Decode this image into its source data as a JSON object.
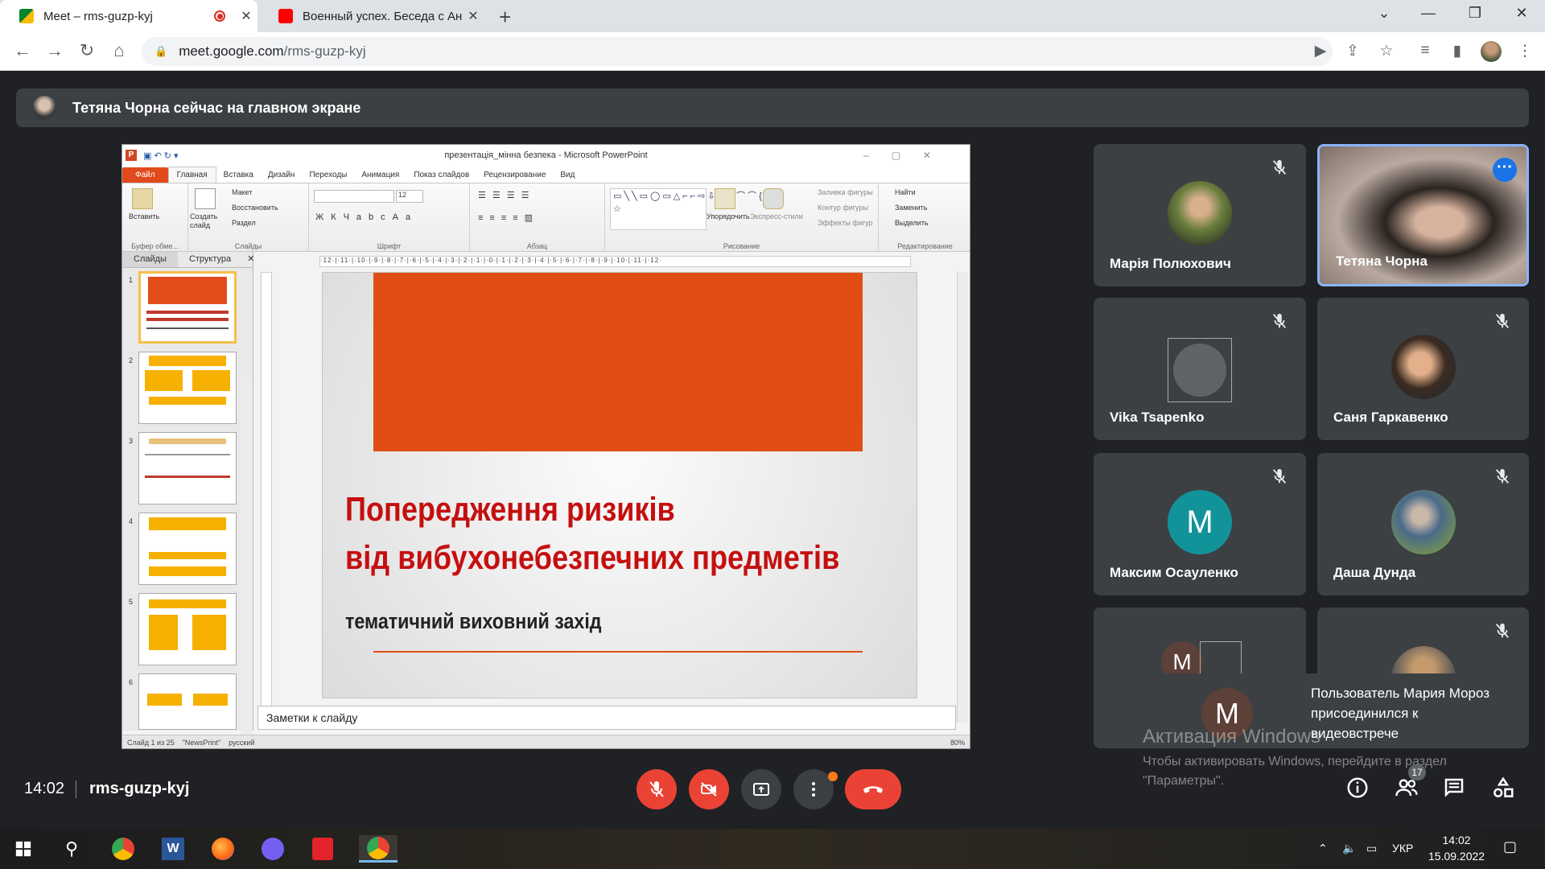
{
  "browser": {
    "tabs": [
      {
        "title": "Meet – rms-guzp-kyj",
        "active": true
      },
      {
        "title": "Военный успех. Беседа с Андреем",
        "active": false
      }
    ],
    "url_host": "meet.google.com",
    "url_path": "/rms-guzp-kyj"
  },
  "presentation_banner": "Тетяна Чорна сейчас на главном экране",
  "powerpoint": {
    "window_title": "презентація_мінна безпека - Microsoft PowerPoint",
    "menu": [
      "Файл",
      "Главная",
      "Вставка",
      "Дизайн",
      "Переходы",
      "Анимация",
      "Показ слайдов",
      "Рецензирование",
      "Вид"
    ],
    "groups": {
      "clipboard": "Буфер обме...",
      "slides": "Слайды",
      "font": "Шрифт",
      "paragraph": "Абзац",
      "drawing": "Рисование",
      "editing": "Редактирование"
    },
    "buttons": {
      "paste": "Вставить",
      "new_slide": "Создать слайд",
      "layout": "Макет",
      "reset": "Восстановить",
      "section": "Раздел",
      "arrange": "Упорядочить",
      "quick_styles": "Экспресс-стили",
      "shape_fill": "Заливка фигуры",
      "shape_outline": "Контур фигуры",
      "shape_effects": "Эффекты фигур",
      "find": "Найти",
      "replace": "Заменить",
      "select": "Выделить",
      "font_size": "12"
    },
    "pane_tabs": [
      "Слайды",
      "Структура"
    ],
    "thumb_numbers": [
      "1",
      "2",
      "3",
      "4",
      "5",
      "6"
    ],
    "slide": {
      "line1": "Попередження ризиків",
      "line2": "від вибухонебезпечних предметів",
      "subtitle": "тематичний виховний захід"
    },
    "notes_placeholder": "Заметки к слайду",
    "status": {
      "slide_counter": "Слайд 1 из 25",
      "theme": "\"NewsPrint\"",
      "language": "русский",
      "zoom": "80%"
    }
  },
  "participants": [
    {
      "name": "Марія Полюхович",
      "muted": true,
      "avatar": "photo"
    },
    {
      "name": "Тетяна Чорна",
      "muted": false,
      "avatar": "video",
      "speaking": true
    },
    {
      "name": "Vika Tsapenko",
      "muted": true,
      "avatar": "broken-image"
    },
    {
      "name": "Саня Гаркавенко",
      "muted": true,
      "avatar": "photo"
    },
    {
      "name": "Максим Осауленко",
      "muted": true,
      "avatar": "letter",
      "letter": "M"
    },
    {
      "name": "Даша Дунда",
      "muted": true,
      "avatar": "photo"
    }
  ],
  "toast": {
    "letter": "M",
    "text": "Пользователь Мария Мороз присоединился к видеовстрече"
  },
  "extra_tile_letter": "M",
  "windows_activation": {
    "title": "Активация Windows",
    "text": "Чтобы активировать Windows, перейдите в раздел \"Параметры\"."
  },
  "meeting": {
    "time": "14:02",
    "code": "rms-guzp-kyj",
    "participant_count": "17"
  },
  "taskbar": {
    "language": "УКР",
    "time": "14:02",
    "date": "15.09.2022"
  },
  "colors": {
    "meet_bg": "#202124",
    "tile_bg": "#3c4043",
    "end_call": "#ea4335",
    "slide_orange": "#e14e15",
    "slide_title_red": "#c50f0f"
  }
}
